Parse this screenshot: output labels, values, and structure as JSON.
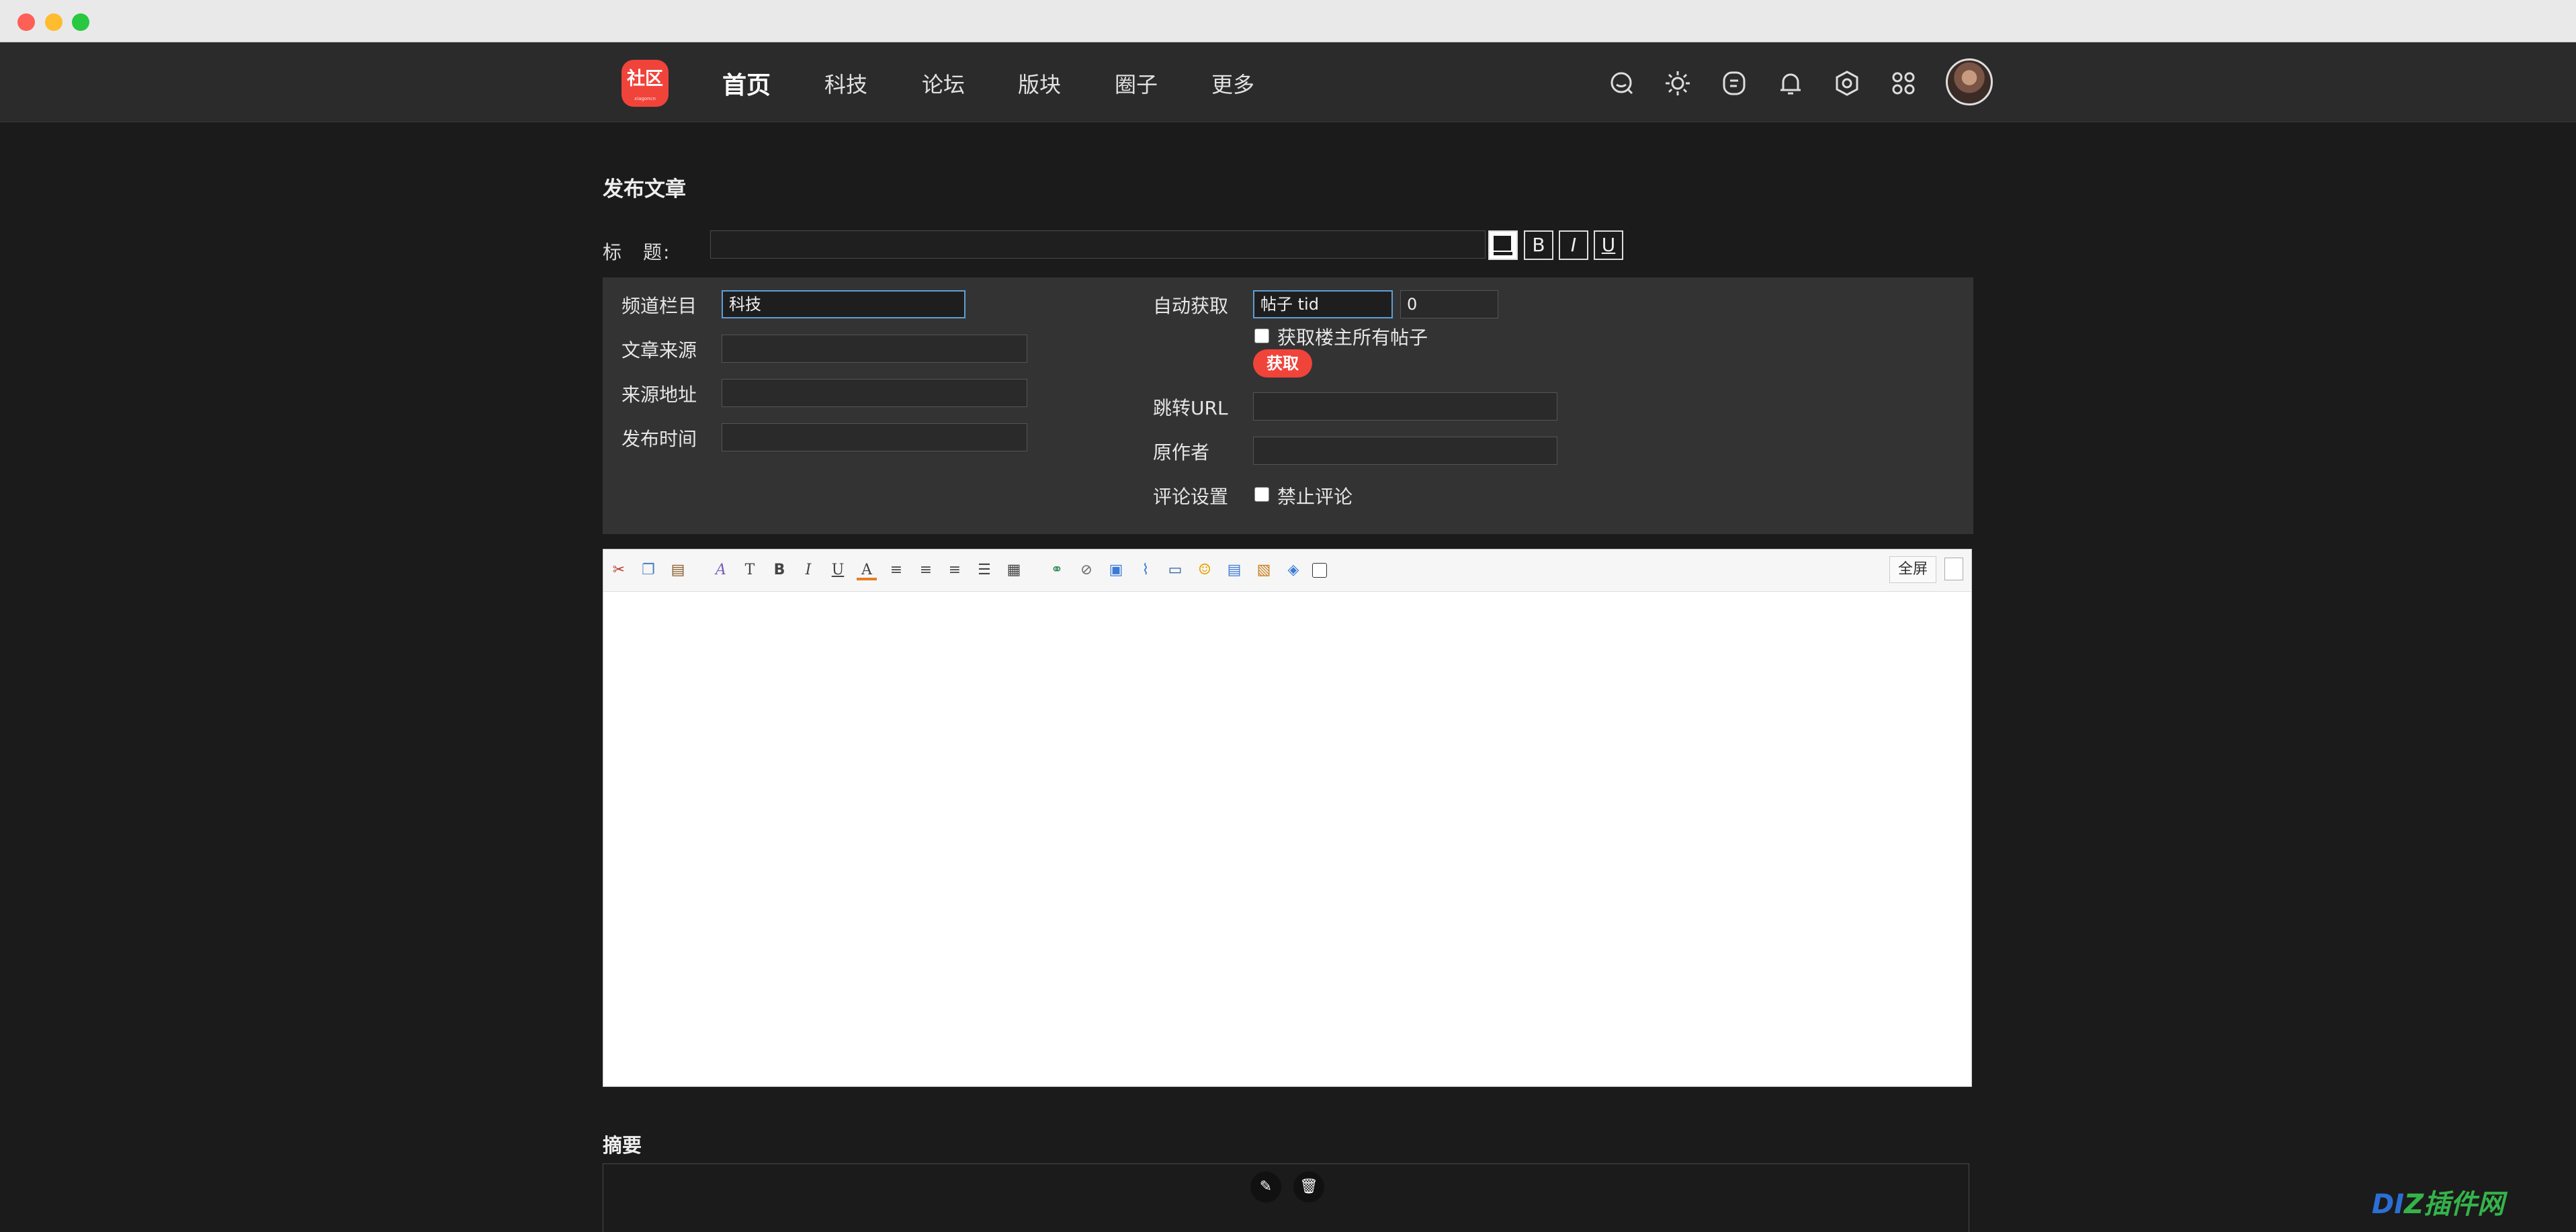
{
  "nav": {
    "logo_text": "社区",
    "logo_sub": "xiagoncn",
    "items": [
      "首页",
      "科技",
      "论坛",
      "版块",
      "圈子",
      "更多"
    ],
    "icons": [
      "chat-icon",
      "sun-icon",
      "message-icon",
      "bell-icon",
      "settings-icon",
      "apps-icon"
    ]
  },
  "form": {
    "page_title": "发布文章",
    "title_label": "标　题:",
    "title_value": "",
    "format_buttons": [
      "B",
      "I",
      "U"
    ],
    "left_fields": [
      {
        "label": "频道栏目",
        "value": "科技"
      },
      {
        "label": "文章来源",
        "value": ""
      },
      {
        "label": "来源地址",
        "value": ""
      },
      {
        "label": "发布时间",
        "value": ""
      }
    ],
    "auto_fetch_label": "自动获取",
    "tid_value": "帖子 tid",
    "page_value": "0",
    "fetch_all_label": "获取楼主所有帖子",
    "fetch_button": "获取",
    "jump_url_label": "跳转URL",
    "jump_url_value": "",
    "author_label": "原作者",
    "author_value": "",
    "comment_label": "评论设置",
    "comment_option": "禁止评论"
  },
  "editor": {
    "fullscreen": "全屏",
    "tool_icons": [
      "cut-icon",
      "copy-icon",
      "paste-icon",
      "font-icon",
      "font-size-icon",
      "bold-icon",
      "italic-icon",
      "underline-icon",
      "font-color-icon",
      "align-left-icon",
      "align-center-icon",
      "align-right-icon",
      "ordered-list-icon",
      "unordered-list-icon",
      "link-icon",
      "unlink-icon",
      "image-icon",
      "attachment-icon",
      "media-icon",
      "smiley-icon",
      "table-icon",
      "multi-image-icon",
      "insert-file-icon"
    ]
  },
  "summary": {
    "title": "摘要"
  },
  "watermark": {
    "text_a": "DI",
    "text_b": "Z插件网"
  },
  "colors": {
    "accent": "#f0433a",
    "page_bg": "#1b1b1b",
    "nav_bg": "#2b2b2b",
    "panel_bg": "#333333",
    "focus": "#5e9ed6"
  }
}
